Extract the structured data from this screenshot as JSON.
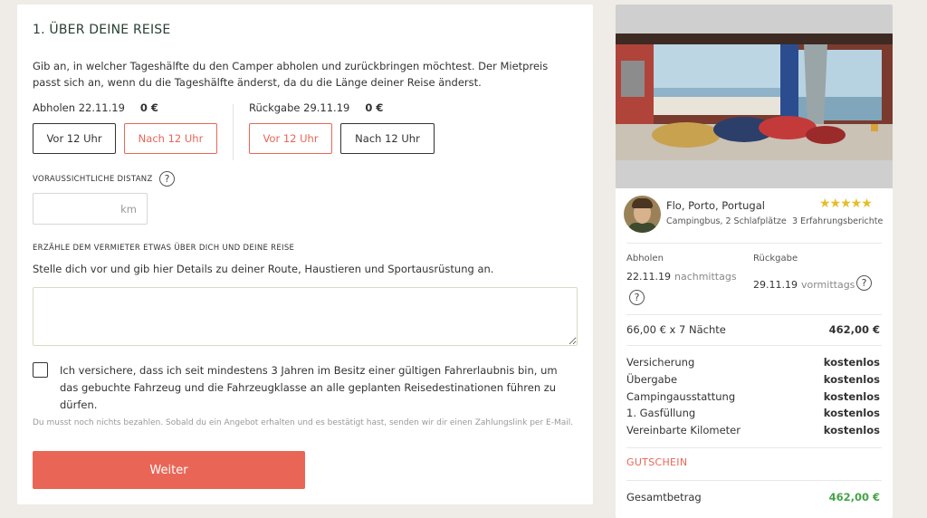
{
  "form": {
    "section_title": "1. ÜBER DEINE REISE",
    "intro": "Gib an, in welcher Tageshälfte du den Camper abholen und zurückbringen möchtest. Der Mietpreis passt sich an, wenn du die Tageshälfte änderst, da du die Länge deiner Reise änderst.",
    "pickup": {
      "label": "Abholen 22.11.19",
      "price": "0 €",
      "option_before": "Vor 12 Uhr",
      "option_after": "Nach 12 Uhr",
      "selected": "Nach 12 Uhr"
    },
    "return": {
      "label": "Rückgabe 29.11.19",
      "price": "0 €",
      "option_before": "Vor 12 Uhr",
      "option_after": "Nach 12 Uhr",
      "selected": "Vor 12 Uhr"
    },
    "distance": {
      "label": "VORAUSSICHTLICHE DISTANZ",
      "value": "",
      "unit": "km",
      "help": "?"
    },
    "about": {
      "label": "ERZÄHLE DEM VERMIETER ETWAS ÜBER DICH UND DEINE REISE",
      "hint": "Stelle dich vor und gib hier Details zu deiner Route, Haustieren und Sportausrüstung an.",
      "value": ""
    },
    "license_checkbox": {
      "checked": false,
      "text": "Ich versichere, dass ich seit mindestens 3 Jahren im Besitz einer gültigen Fahrerlaubnis bin, um das gebuchte Fahrzeug und die Fahrzeugklasse an alle geplanten Reisedestinationen führen zu dürfen."
    },
    "payment_note": "Du musst noch nichts bezahlen. Sobald du ein Angebot erhalten und es bestätigt hast, senden wir dir einen Zahlungslink per E-Mail.",
    "submit_label": "Weiter"
  },
  "summary": {
    "owner": "Flo, Porto, Portugal",
    "vehicle": "Campingbus, 2 Schlafplätze",
    "rating_stars": "★★★★★",
    "rating": 5,
    "reviews": "3 Erfahrungsberichte",
    "pickup_label": "Abholen",
    "pickup_date": "22.11.19",
    "pickup_time": "nachmittags",
    "return_label": "Rückgabe",
    "return_date": "29.11.19",
    "return_time": "vormittags",
    "help": "?",
    "nights_label": "66,00 € x 7 Nächte",
    "nights_price": "462,00 €",
    "extras": [
      {
        "label": "Versicherung",
        "value": "kostenlos"
      },
      {
        "label": "Übergabe",
        "value": "kostenlos"
      },
      {
        "label": "Campingausstattung",
        "value": "kostenlos"
      },
      {
        "label": "1. Gasfüllung",
        "value": "kostenlos"
      },
      {
        "label": "Vereinbarte Kilometer",
        "value": "kostenlos"
      }
    ],
    "voucher_label": "GUTSCHEIN",
    "total_label": "Gesamtbetrag",
    "total_value": "462,00 €",
    "accent_color": "#e96656",
    "total_color": "#46a34a",
    "star_color": "#e6bd2a"
  }
}
